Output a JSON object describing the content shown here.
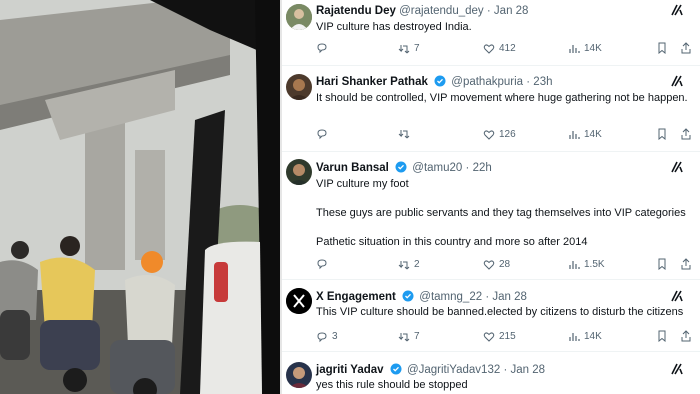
{
  "tweets": [
    {
      "name": "Rajatendu Dey",
      "handle": "@rajatendu_dey",
      "time": "Jan 28",
      "text": [
        "VIP culture has destroyed India."
      ],
      "replies": "",
      "retweets": "7",
      "likes": "412",
      "views": "14K"
    },
    {
      "name": "Hari Shanker Pathak",
      "handle": "@pathakpuria",
      "time": "23h",
      "text": [
        "It should be controlled, VIP movement where huge gathering not be happen."
      ],
      "replies": "",
      "retweets": "",
      "likes": "126",
      "views": "14K"
    },
    {
      "name": "Varun Bansal",
      "handle": "@tamu20",
      "time": "22h",
      "text": [
        "VIP culture my foot",
        "These guys are public servants and they tag themselves into VIP categories",
        "Pathetic situation in this country and more so after 2014"
      ],
      "replies": "",
      "retweets": "2",
      "likes": "28",
      "views": "1.5K"
    },
    {
      "name": "X Engagement",
      "handle": "@tamng_22",
      "time": "Jan 28",
      "text": [
        "This VIP culture should be banned.elected by citizens to disturb the citizens"
      ],
      "replies": "3",
      "retweets": "7",
      "likes": "215",
      "views": "14K"
    },
    {
      "name": "jagriti Yadav",
      "handle": "@JagritiYadav132",
      "time": "Jan 28",
      "text": [
        "yes this rule should be stopped"
      ],
      "replies": "",
      "retweets": "",
      "likes": "",
      "views": ""
    }
  ],
  "separator": "·",
  "icons": {
    "reply": "reply-icon",
    "retweet": "retweet-icon",
    "like": "heart-icon",
    "views": "views-icon",
    "bookmark": "bookmark-icon",
    "share": "share-icon",
    "verified": "verified-badge-icon",
    "grok": "grok-icon"
  },
  "colors": {
    "verified": "#1d9bf0",
    "muted": "#536471",
    "text": "#0f1419"
  }
}
